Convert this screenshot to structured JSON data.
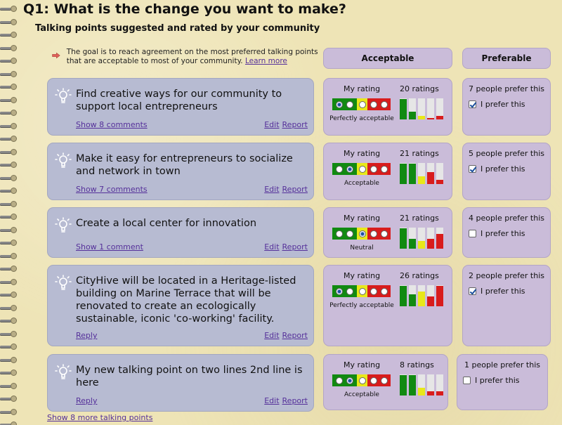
{
  "header": {
    "title": "Q1: What is the change you want to make?",
    "subtitle": "Talking points suggested and rated by your community"
  },
  "intro": {
    "text": "The goal is to reach agreement on the most preferred talking points that are acceptable to most of your community.",
    "learn_more": "Learn more"
  },
  "columns": {
    "acceptable": "Acceptable",
    "preferable": "Preferable"
  },
  "labels": {
    "my_rating": "My rating",
    "edit": "Edit",
    "report": "Report",
    "i_prefer": "I prefer this"
  },
  "colors": {
    "green": "#118a11",
    "yellow": "#e8e81a",
    "red": "#d81c1c"
  },
  "talking_points": [
    {
      "text": "Find creative ways for our community to support local entrepreneurs",
      "footer_link": "Show 8 comments",
      "ratings_count": "20 ratings",
      "my_rating_word": "Perfectly acceptable",
      "selected_index": 1,
      "distribution": [
        0.95,
        0.35,
        0.15,
        0.08,
        0.15
      ],
      "prefer_count": "7 people prefer this",
      "prefer_checked": true
    },
    {
      "text": "Make it easy for entrepreneurs to socialize and network in town",
      "footer_link": "Show 7 comments",
      "ratings_count": "21 ratings",
      "my_rating_word": "Acceptable",
      "selected_index": 2,
      "distribution": [
        0.95,
        0.95,
        0.35,
        0.55,
        0.2
      ],
      "prefer_count": "5 people prefer this",
      "prefer_checked": true
    },
    {
      "text": "Create a local center for innovation",
      "footer_link": "Show 1 comment",
      "ratings_count": "21 ratings",
      "my_rating_word": "Neutral",
      "selected_index": 3,
      "distribution": [
        0.95,
        0.45,
        0.35,
        0.45,
        0.7
      ],
      "prefer_count": "4 people prefer this",
      "prefer_checked": false
    },
    {
      "text": "CityHive will be located in a Heritage-listed building on Marine Terrace that will be renovated to create an ecologically sustainable, iconic 'co-working' facility.",
      "footer_link": "Reply",
      "ratings_count": "26 ratings",
      "my_rating_word": "Perfectly acceptable",
      "selected_index": 1,
      "distribution": [
        0.95,
        0.55,
        0.7,
        0.45,
        0.95
      ],
      "prefer_count": "2 people prefer this",
      "prefer_checked": true
    },
    {
      "text": "My new talking point on two lines 2nd line is here",
      "footer_link": "Reply",
      "ratings_count": "8 ratings",
      "my_rating_word": "Acceptable",
      "selected_index": 2,
      "distribution": [
        0.95,
        0.95,
        0.35,
        0.2,
        0.2
      ],
      "prefer_count": "1 people prefer this",
      "prefer_checked": false
    }
  ],
  "show_more": "Show 8 more talking points"
}
